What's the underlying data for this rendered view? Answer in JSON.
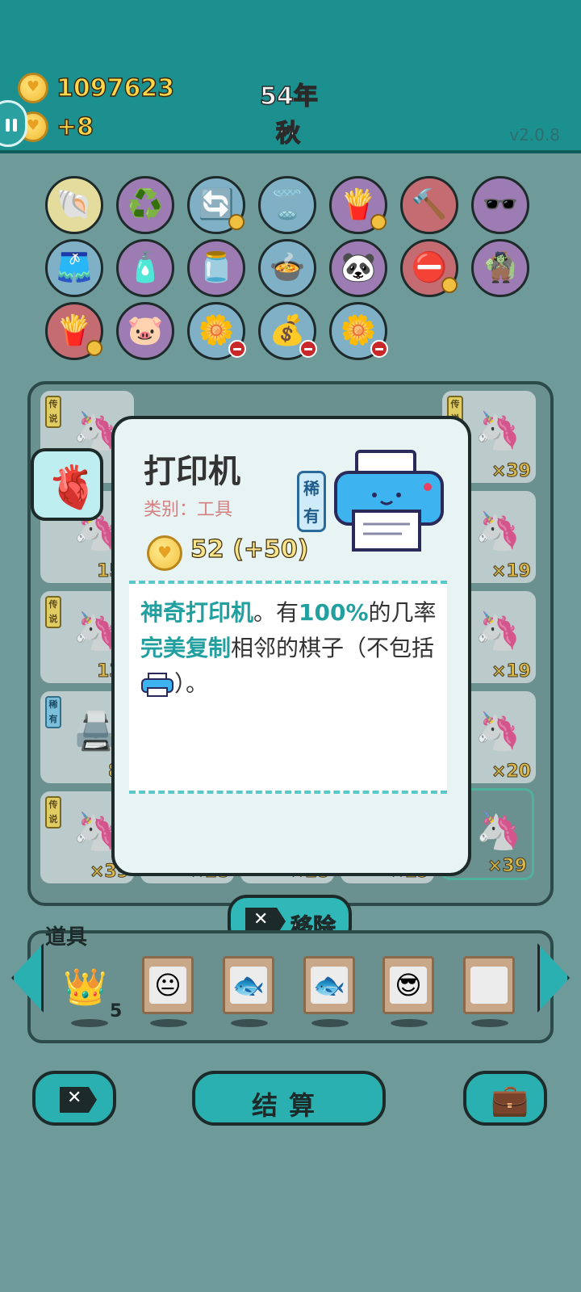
{
  "header": {
    "coins": "1097623",
    "income": "+8",
    "year": "54年",
    "season": "秋",
    "version": "v2.0.8"
  },
  "items_row1": [
    "🐚",
    "♻️",
    "🔄",
    "🗑️",
    "🍟",
    "🔨",
    "🕶️"
  ],
  "items_row2": [
    "🩳",
    "🧴",
    "🫙",
    "🍲",
    "🐼",
    "⛔",
    "🧌"
  ],
  "items_row3": [
    "🍟",
    "🐷",
    "🌼",
    "💰",
    "🌼"
  ],
  "board": {
    "tag_legend": "传说",
    "tag_rare": "稀有",
    "counts": [
      "×39",
      "×19",
      "×19",
      "×20",
      "×39",
      "×39",
      "×18",
      "×18",
      "×19",
      "15",
      "13",
      "8"
    ]
  },
  "popup": {
    "title": "打印机",
    "category": "类别：工具",
    "value": "52 (+50)",
    "rarity": "稀有",
    "desc_part1": "神奇打印机",
    "desc_part2": "。有",
    "desc_part3": "100%",
    "desc_part4": "的几率",
    "desc_part5": "完美复制",
    "desc_part6": "相邻的棋子（不包括",
    "desc_part7": "）。"
  },
  "remove_label": "移除",
  "tools": {
    "label": "道具",
    "crown_count": "5"
  },
  "bottom": {
    "settle_label": "结算"
  }
}
